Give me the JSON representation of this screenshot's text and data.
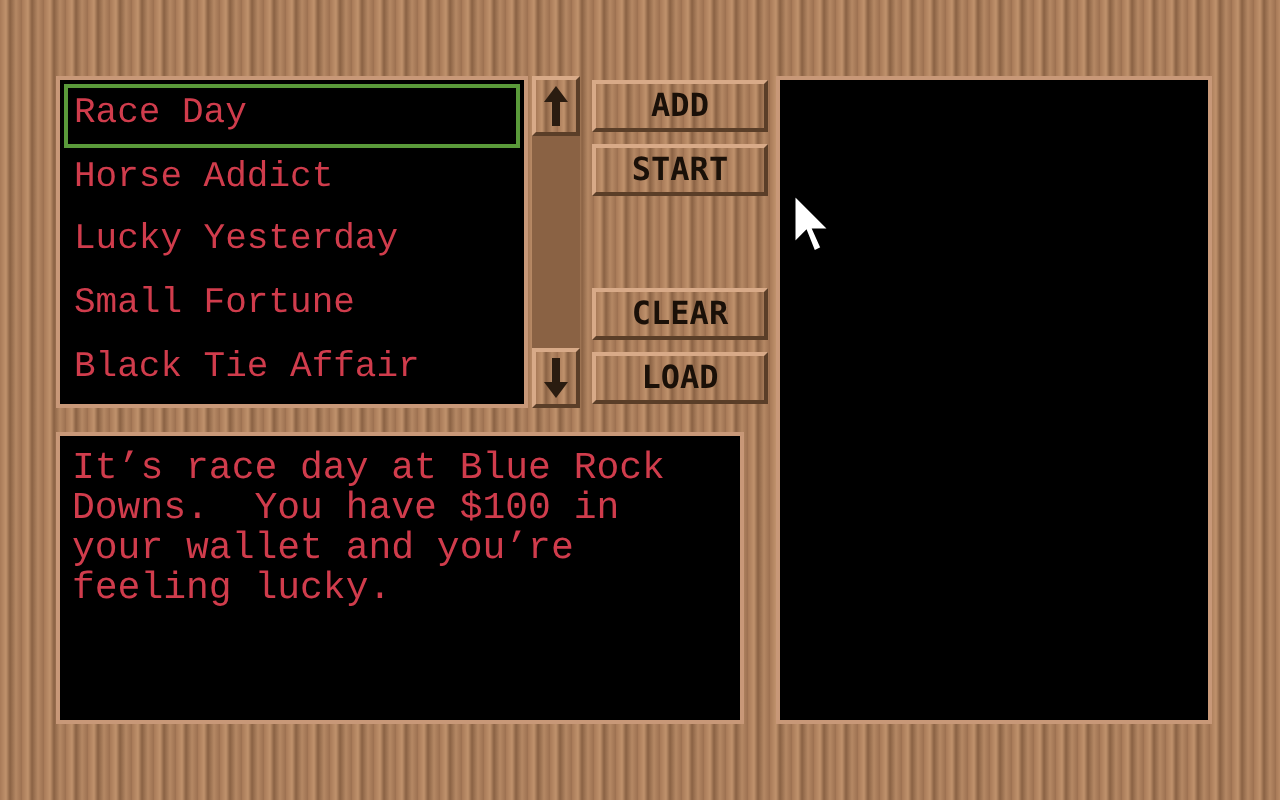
{
  "scenarios": [
    {
      "label": "Race Day",
      "selected": true
    },
    {
      "label": "Horse Addict",
      "selected": false
    },
    {
      "label": "Lucky Yesterday",
      "selected": false
    },
    {
      "label": "Small Fortune",
      "selected": false
    },
    {
      "label": "Black Tie Affair",
      "selected": false
    }
  ],
  "buttons": [
    {
      "label": "ADD",
      "kind": "top"
    },
    {
      "label": "START",
      "kind": "top"
    },
    {
      "label": "CLEAR",
      "kind": "bottom"
    },
    {
      "label": "LOAD",
      "kind": "bottom"
    }
  ],
  "description": "It’s race day at Blue Rock Downs.  You have $100 in your wallet and you’re feeling lucky."
}
